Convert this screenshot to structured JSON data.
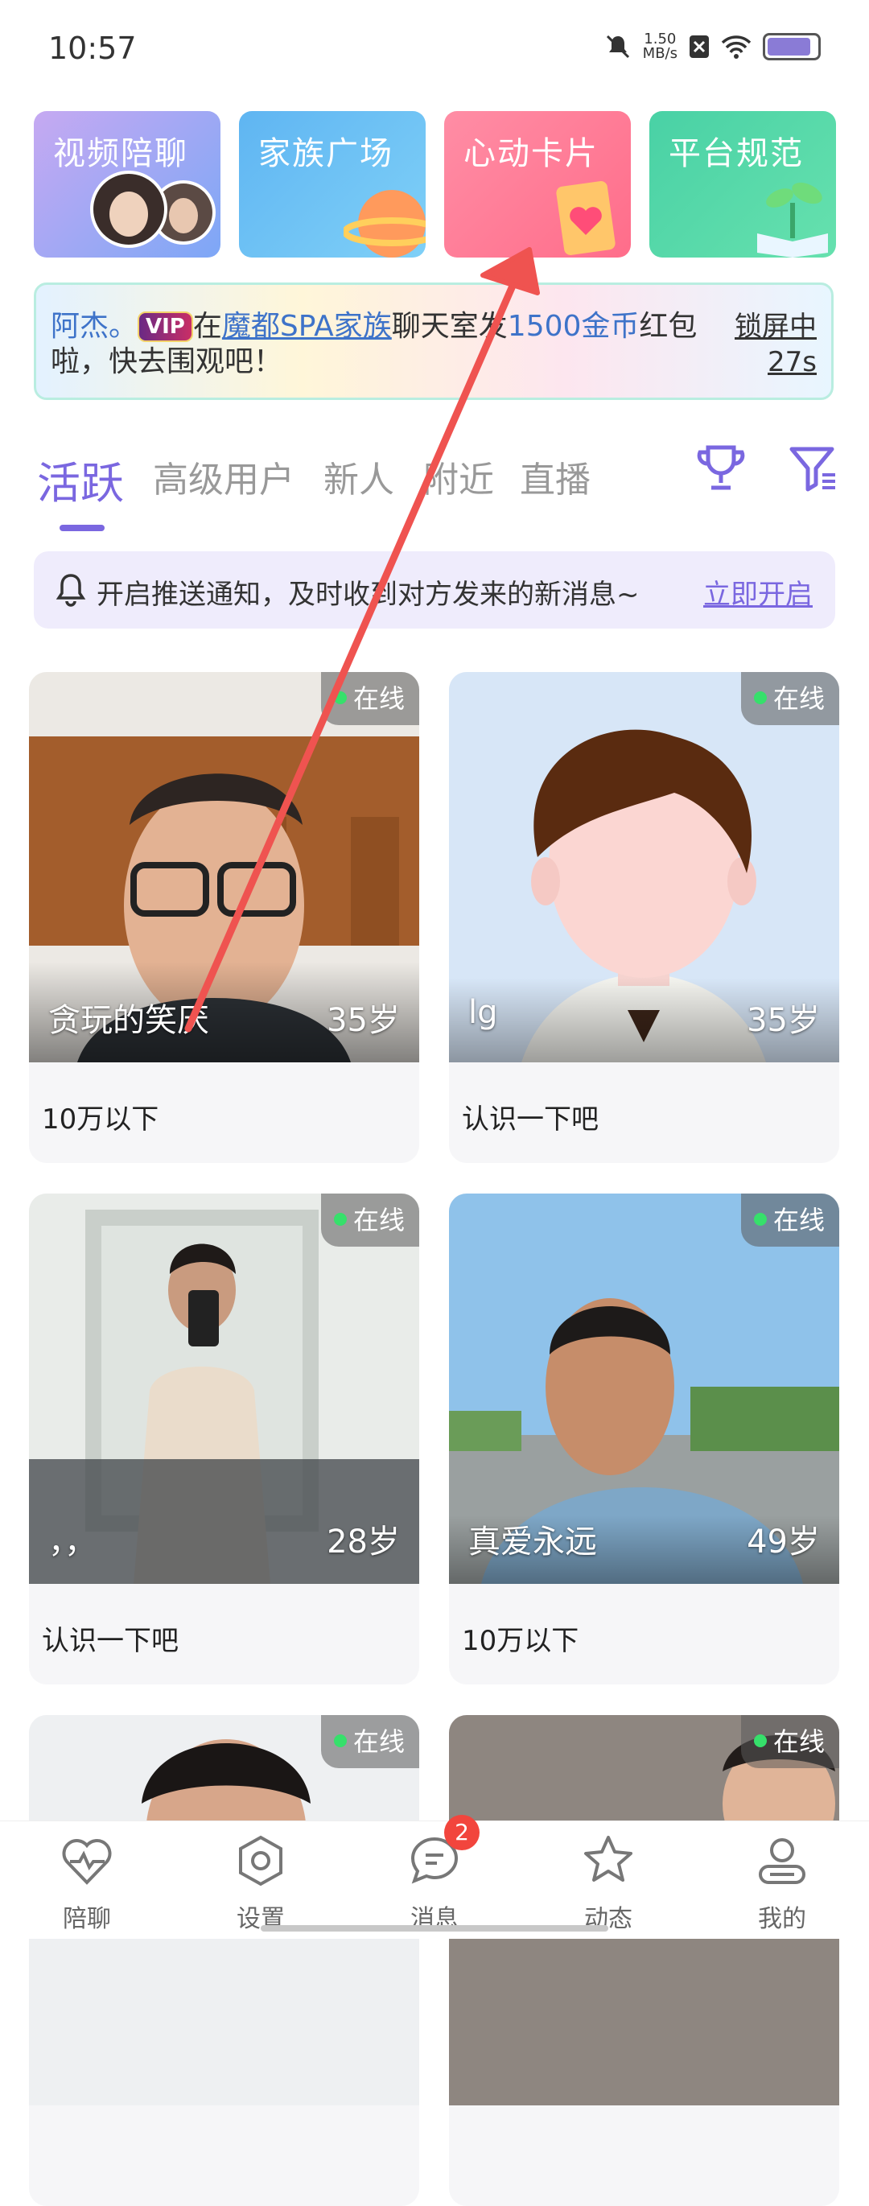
{
  "status_bar": {
    "time": "10:57",
    "net_speed": "1.50",
    "net_unit": "MB/s"
  },
  "top_cards": [
    {
      "label": "视频陪聊"
    },
    {
      "label": "家族广场"
    },
    {
      "label": "心动卡片"
    },
    {
      "label": "平台规范"
    }
  ],
  "banner": {
    "name": "阿杰。",
    "vip": "VIP",
    "in": "在",
    "family": "魔都SPA家族",
    "chat": "聊天室发",
    "coins": "1500金币",
    "rest": "红包啦，快去围观吧！",
    "lock_label": "锁屏中",
    "lock_time": "27s"
  },
  "tabs": [
    "活跃",
    "高级用户",
    "新人",
    "附近",
    "直播"
  ],
  "notice": {
    "text": "开启推送通知，及时收到对方发来的新消息~",
    "action": "立即开启"
  },
  "users": [
    {
      "name": "贪玩的笑厌",
      "age": "35岁",
      "bio": "10万以下",
      "status": "在线"
    },
    {
      "name": "lg",
      "age": "35岁",
      "bio": "认识一下吧",
      "status": "在线"
    },
    {
      "name": "，，",
      "age": "28岁",
      "bio": "认识一下吧",
      "status": "在线"
    },
    {
      "name": "真爱永远",
      "age": "49岁",
      "bio": "10万以下",
      "status": "在线"
    },
    {
      "name": "",
      "age": "",
      "bio": "",
      "status": "在线"
    },
    {
      "name": "",
      "age": "",
      "bio": "",
      "status": "在线"
    }
  ],
  "nav": [
    {
      "label": "陪聊",
      "icon": "heart-pulse-icon"
    },
    {
      "label": "设置",
      "icon": "gear-icon"
    },
    {
      "label": "消息",
      "icon": "chat-icon",
      "badge": "2"
    },
    {
      "label": "动态",
      "icon": "star-icon"
    },
    {
      "label": "我的",
      "icon": "profile-icon"
    }
  ],
  "colors": {
    "accent": "#7a67e0",
    "online": "#36e06b",
    "badge": "#f2453d",
    "arrow": "#ef5350"
  }
}
